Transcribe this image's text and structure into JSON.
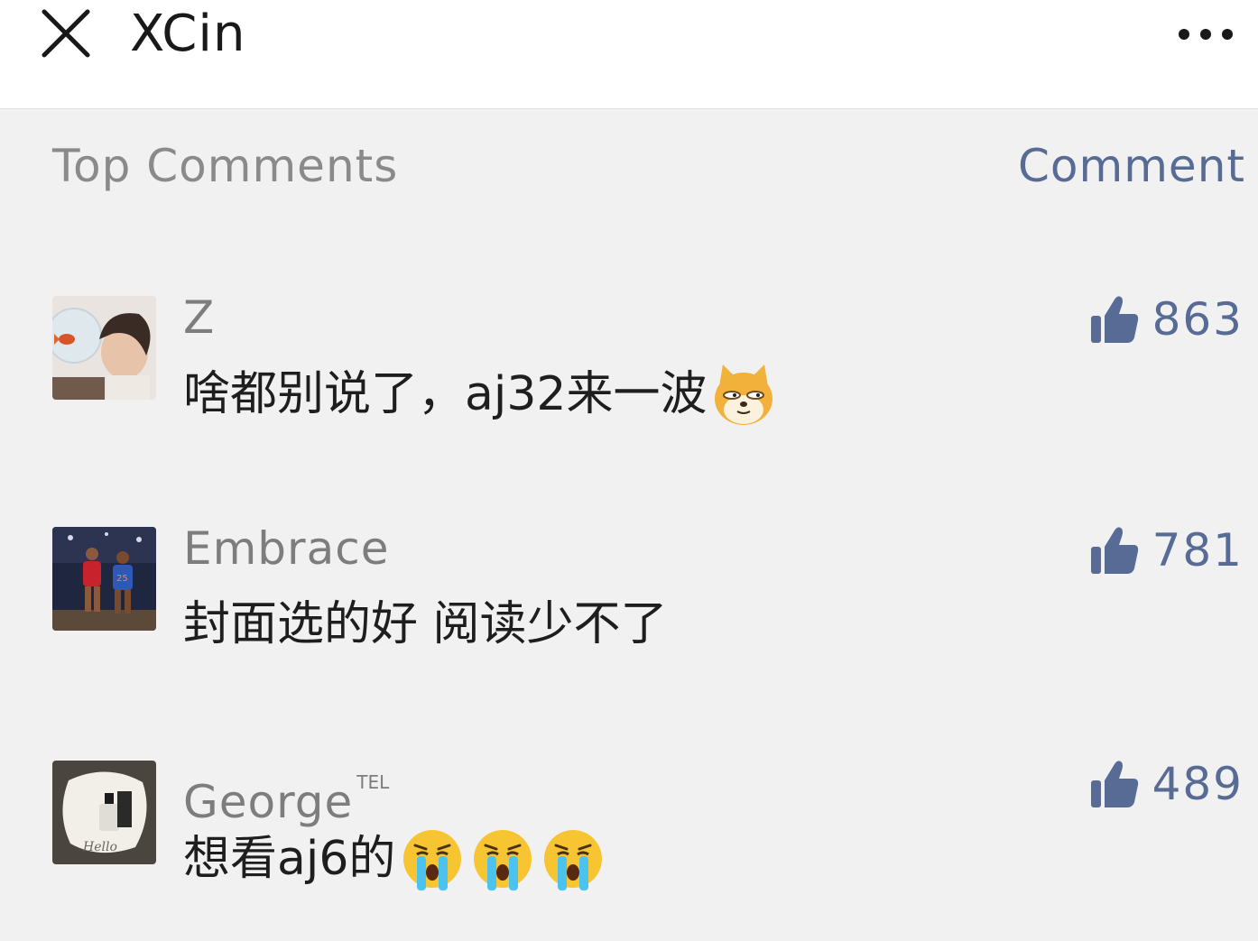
{
  "header": {
    "close_icon": "close-icon",
    "title": "XCin",
    "more_icon": "more-dots-icon"
  },
  "section": {
    "title": "Top Comments",
    "comment_link": "Comment"
  },
  "colors": {
    "link_blue": "#576b95",
    "page_bg": "#f1f1f1",
    "header_bg": "#ffffff"
  },
  "comments": [
    {
      "avatar": "avatar-boy-with-fishbowl",
      "nickname": "Z",
      "nickname_badge": "",
      "text": "啥都别说了，aj32来一波",
      "emojis": [
        "doge-emoji"
      ],
      "likes": "863"
    },
    {
      "avatar": "avatar-basketball-players",
      "nickname": "Embrace",
      "nickname_badge": "",
      "text": "封面选的好 阅读少不了",
      "emojis": [],
      "likes": "781"
    },
    {
      "avatar": "avatar-hello-album-cover",
      "nickname": "George",
      "nickname_badge": "TEL",
      "text": "想看aj6的",
      "emojis": [
        "crying-face-emoji",
        "crying-face-emoji",
        "crying-face-emoji"
      ],
      "likes": "489"
    }
  ]
}
